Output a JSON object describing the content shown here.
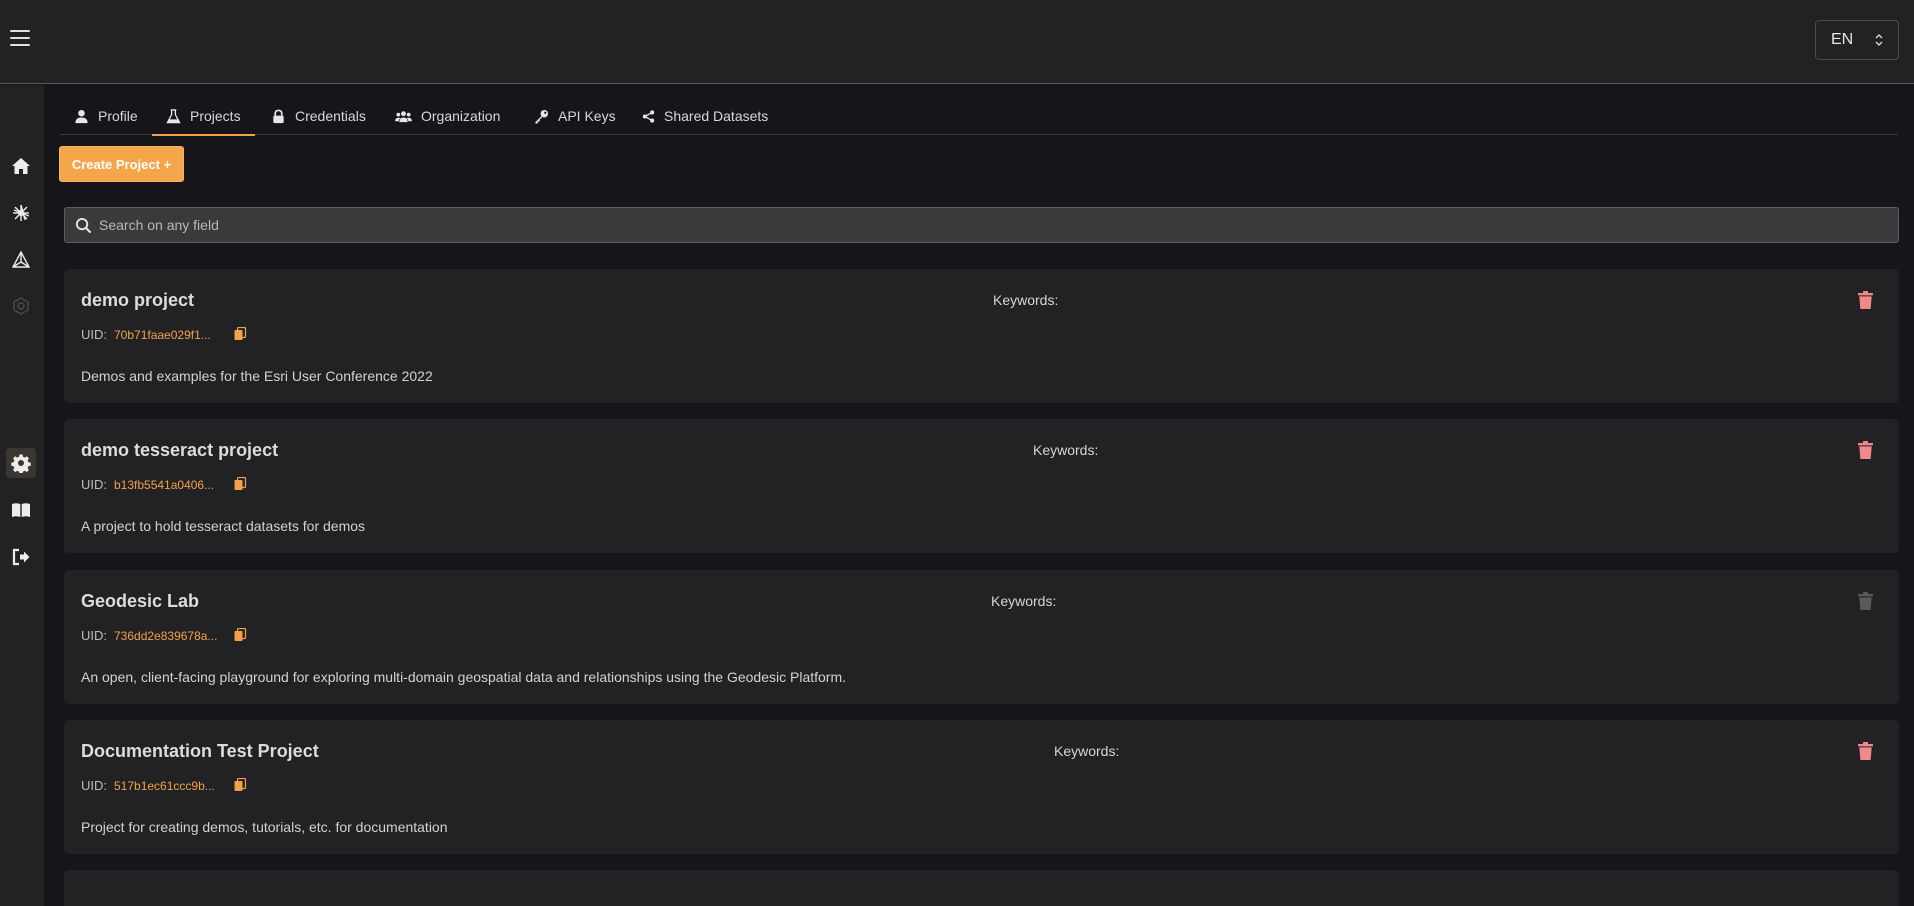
{
  "header": {
    "language": "EN"
  },
  "tabs": [
    {
      "label": "Profile",
      "icon": "user-icon"
    },
    {
      "label": "Projects",
      "icon": "flask-icon",
      "active": true
    },
    {
      "label": "Credentials",
      "icon": "lock-icon"
    },
    {
      "label": "Organization",
      "icon": "users-icon"
    },
    {
      "label": "API Keys",
      "icon": "key-icon"
    },
    {
      "label": "Shared Datasets",
      "icon": "share-icon"
    }
  ],
  "toolbar": {
    "create_label": "Create Project +"
  },
  "search": {
    "placeholder": "Search on any field"
  },
  "projects": [
    {
      "title": "demo project",
      "keywords_label": "Keywords:",
      "uid_label": "UID:",
      "uid": "70b71faae029f1...",
      "description": "Demos and examples for the Esri User Conference 2022",
      "deletable": true
    },
    {
      "title": "demo tesseract project",
      "keywords_label": "Keywords:",
      "uid_label": "UID:",
      "uid": "b13fb5541a0406...",
      "description": "A project to hold tesseract datasets for demos",
      "deletable": true
    },
    {
      "title": "Geodesic Lab",
      "keywords_label": "Keywords:",
      "uid_label": "UID:",
      "uid": "736dd2e839678a...",
      "description": "An open, client-facing playground for exploring multi-domain geospatial data and relationships using the Geodesic Platform.",
      "deletable": false
    },
    {
      "title": "Documentation Test Project",
      "keywords_label": "Keywords:",
      "uid_label": "UID:",
      "uid": "517b1ec61ccc9b...",
      "description": "Project for creating demos, tutorials, etc. for documentation",
      "deletable": true
    }
  ],
  "sidebar": {
    "items": [
      {
        "icon": "home-icon"
      },
      {
        "icon": "burst-icon"
      },
      {
        "icon": "network-icon"
      },
      {
        "icon": "hexagon-icon",
        "disabled": true
      },
      {
        "icon": "gear-icon",
        "active": true
      },
      {
        "icon": "book-icon"
      },
      {
        "icon": "logout-icon"
      }
    ]
  },
  "colors": {
    "accent": "#f5a54a",
    "trash_active": "#f08a8a",
    "trash_disabled": "#5a5a5c"
  }
}
